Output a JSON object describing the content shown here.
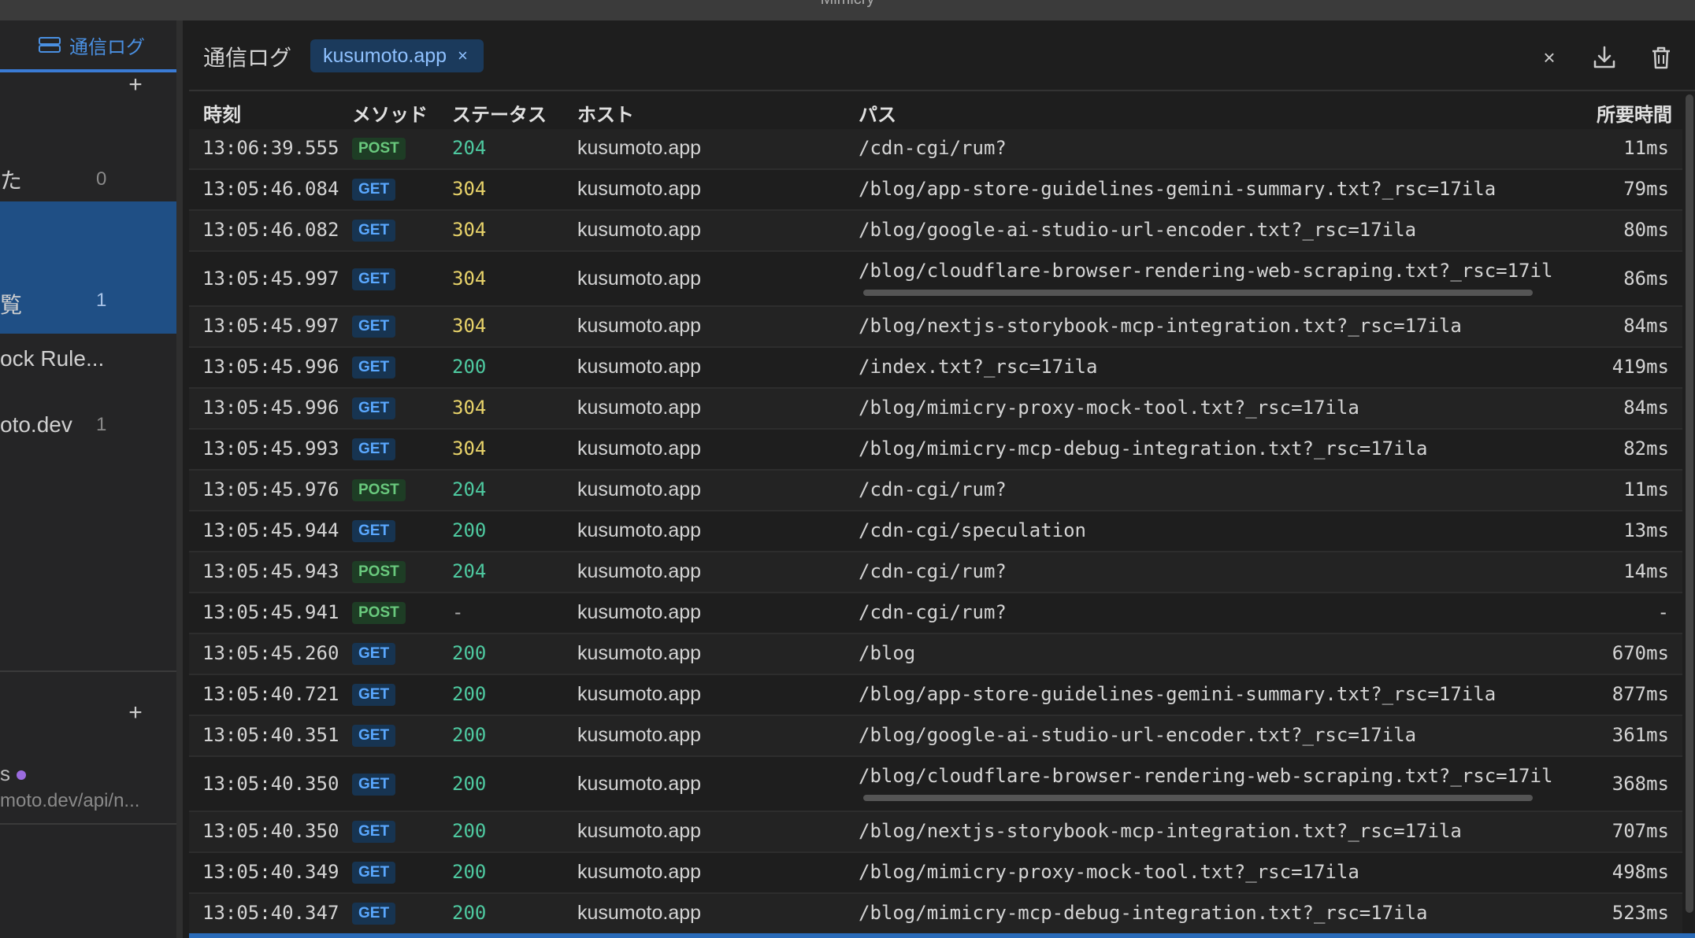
{
  "app": {
    "title": "Mimicry"
  },
  "sidebar": {
    "tab_label": "通信ログ",
    "group1": {
      "items": [
        {
          "label": "た",
          "count": "0"
        },
        {
          "label": "覧",
          "count": "1"
        },
        {
          "label": "ock Rule...",
          "count": ""
        },
        {
          "label": "oto.dev",
          "count": "1"
        }
      ]
    },
    "group2": {
      "item_label": "s",
      "item_sub": "moto.dev/api/n..."
    }
  },
  "toolbar": {
    "title": "通信ログ",
    "filter_chip": "kusumoto.app",
    "chip_close": "×",
    "close_label": "×"
  },
  "table": {
    "headers": {
      "time": "時刻",
      "method": "メソッド",
      "status": "ステータス",
      "host": "ホスト",
      "path": "パス",
      "duration": "所要時間"
    },
    "rows": [
      {
        "time": "13:06:39.555",
        "method": "POST",
        "status": "204",
        "host": "kusumoto.app",
        "path": "/cdn-cgi/rum?",
        "duration": "11ms"
      },
      {
        "time": "13:05:46.084",
        "method": "GET",
        "status": "304",
        "host": "kusumoto.app",
        "path": "/blog/app-store-guidelines-gemini-summary.txt?_rsc=17ila",
        "duration": "79ms"
      },
      {
        "time": "13:05:46.082",
        "method": "GET",
        "status": "304",
        "host": "kusumoto.app",
        "path": "/blog/google-ai-studio-url-encoder.txt?_rsc=17ila",
        "duration": "80ms"
      },
      {
        "time": "13:05:45.997",
        "method": "GET",
        "status": "304",
        "host": "kusumoto.app",
        "path": "/blog/cloudflare-browser-rendering-web-scraping.txt?_rsc=17il",
        "duration": "86ms",
        "scroll": true
      },
      {
        "time": "13:05:45.997",
        "method": "GET",
        "status": "304",
        "host": "kusumoto.app",
        "path": "/blog/nextjs-storybook-mcp-integration.txt?_rsc=17ila",
        "duration": "84ms"
      },
      {
        "time": "13:05:45.996",
        "method": "GET",
        "status": "200",
        "host": "kusumoto.app",
        "path": "/index.txt?_rsc=17ila",
        "duration": "419ms"
      },
      {
        "time": "13:05:45.996",
        "method": "GET",
        "status": "304",
        "host": "kusumoto.app",
        "path": "/blog/mimicry-proxy-mock-tool.txt?_rsc=17ila",
        "duration": "84ms"
      },
      {
        "time": "13:05:45.993",
        "method": "GET",
        "status": "304",
        "host": "kusumoto.app",
        "path": "/blog/mimicry-mcp-debug-integration.txt?_rsc=17ila",
        "duration": "82ms"
      },
      {
        "time": "13:05:45.976",
        "method": "POST",
        "status": "204",
        "host": "kusumoto.app",
        "path": "/cdn-cgi/rum?",
        "duration": "11ms"
      },
      {
        "time": "13:05:45.944",
        "method": "GET",
        "status": "200",
        "host": "kusumoto.app",
        "path": "/cdn-cgi/speculation",
        "duration": "13ms"
      },
      {
        "time": "13:05:45.943",
        "method": "POST",
        "status": "204",
        "host": "kusumoto.app",
        "path": "/cdn-cgi/rum?",
        "duration": "14ms"
      },
      {
        "time": "13:05:45.941",
        "method": "POST",
        "status": "-",
        "host": "kusumoto.app",
        "path": "/cdn-cgi/rum?",
        "duration": "-"
      },
      {
        "time": "13:05:45.260",
        "method": "GET",
        "status": "200",
        "host": "kusumoto.app",
        "path": "/blog",
        "duration": "670ms"
      },
      {
        "time": "13:05:40.721",
        "method": "GET",
        "status": "200",
        "host": "kusumoto.app",
        "path": "/blog/app-store-guidelines-gemini-summary.txt?_rsc=17ila",
        "duration": "877ms"
      },
      {
        "time": "13:05:40.351",
        "method": "GET",
        "status": "200",
        "host": "kusumoto.app",
        "path": "/blog/google-ai-studio-url-encoder.txt?_rsc=17ila",
        "duration": "361ms"
      },
      {
        "time": "13:05:40.350",
        "method": "GET",
        "status": "200",
        "host": "kusumoto.app",
        "path": "/blog/cloudflare-browser-rendering-web-scraping.txt?_rsc=17il",
        "duration": "368ms",
        "scroll": true
      },
      {
        "time": "13:05:40.350",
        "method": "GET",
        "status": "200",
        "host": "kusumoto.app",
        "path": "/blog/nextjs-storybook-mcp-integration.txt?_rsc=17ila",
        "duration": "707ms"
      },
      {
        "time": "13:05:40.349",
        "method": "GET",
        "status": "200",
        "host": "kusumoto.app",
        "path": "/blog/mimicry-proxy-mock-tool.txt?_rsc=17ila",
        "duration": "498ms"
      },
      {
        "time": "13:05:40.347",
        "method": "GET",
        "status": "200",
        "host": "kusumoto.app",
        "path": "/blog/mimicry-mcp-debug-integration.txt?_rsc=17ila",
        "duration": "523ms"
      }
    ]
  },
  "colors": {
    "accent": "#3a7bd5",
    "get_badge": "#5aa8ff",
    "post_badge": "#69c97d",
    "status_2xx": "#4ec9a0",
    "status_3xx": "#e8d36a",
    "sidebar_selected": "#1f4f85"
  }
}
